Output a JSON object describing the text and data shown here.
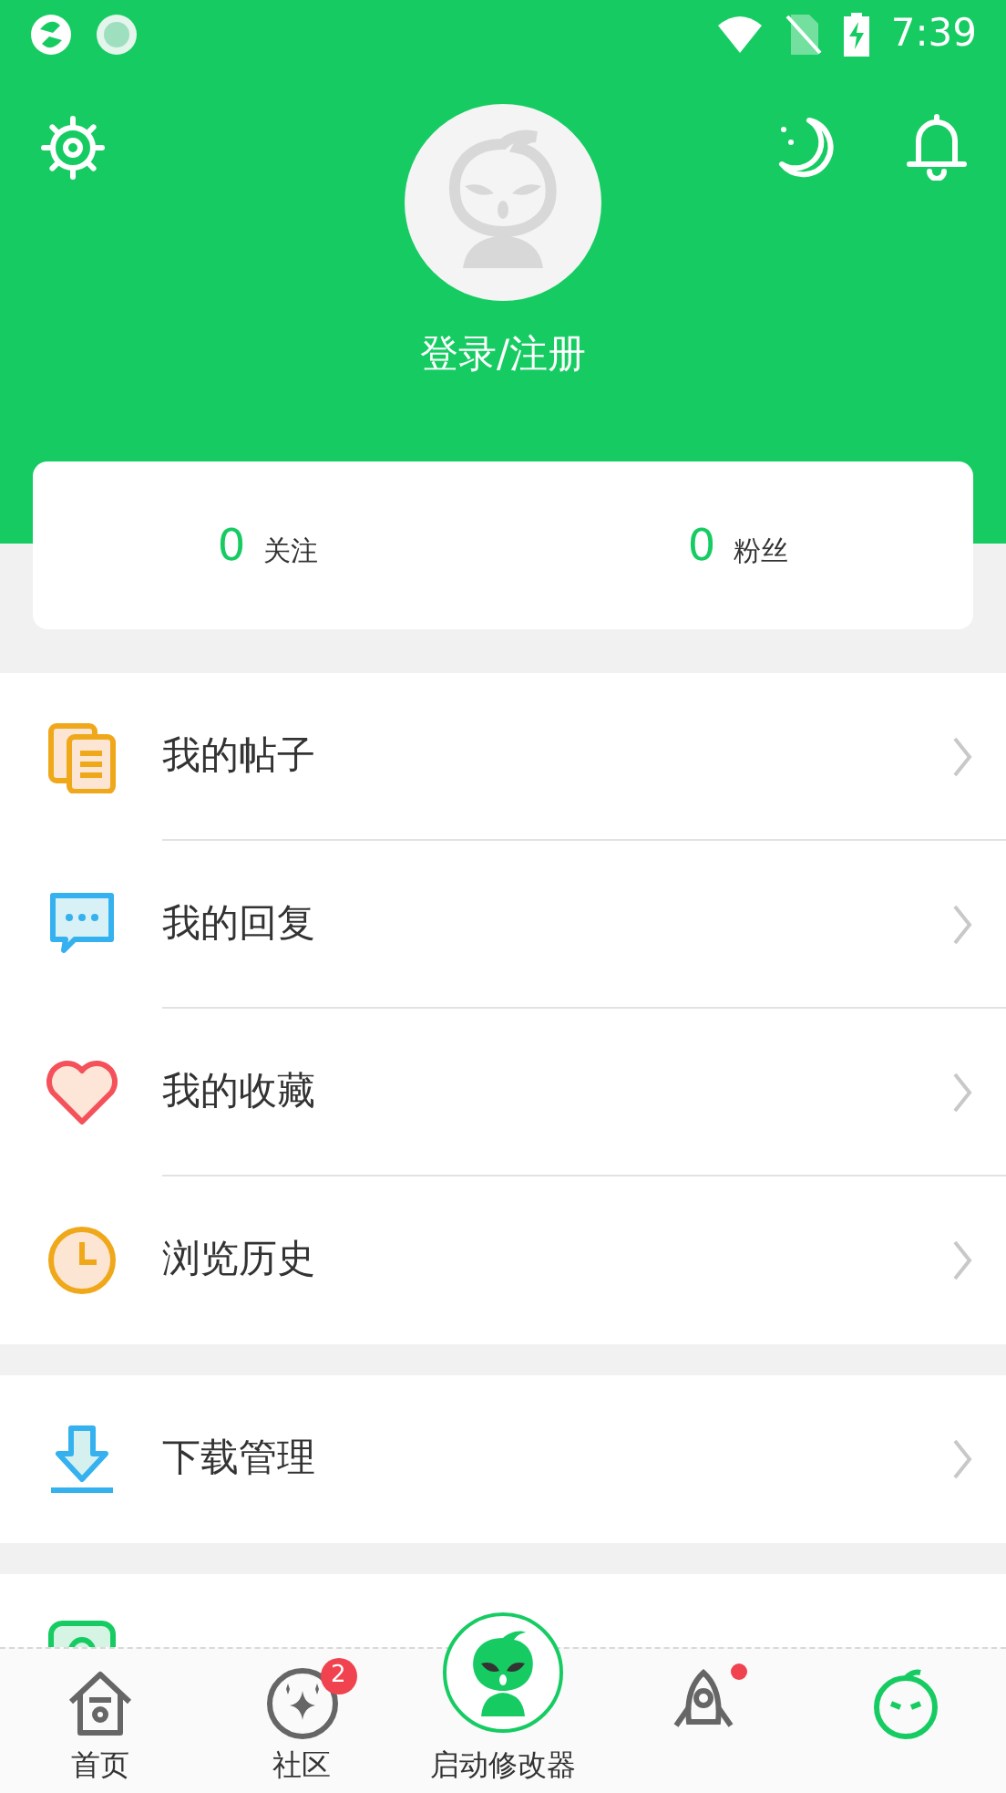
{
  "status_bar": {
    "time": "7:39"
  },
  "header": {
    "login_label": "登录/注册"
  },
  "stats": [
    {
      "count": "0",
      "label": "关注"
    },
    {
      "count": "0",
      "label": "粉丝"
    }
  ],
  "menu_groups": [
    [
      {
        "label": "我的帖子"
      },
      {
        "label": "我的回复"
      },
      {
        "label": "我的收藏"
      },
      {
        "label": "浏览历史"
      }
    ],
    [
      {
        "label": "下载管理"
      }
    ]
  ],
  "bottom_nav": [
    {
      "kind": "tab",
      "label": "首页"
    },
    {
      "kind": "tab",
      "label": "社区",
      "badge": "2"
    },
    {
      "kind": "center",
      "label": "启动修改器"
    },
    {
      "kind": "tab",
      "dot": true
    },
    {
      "kind": "tab"
    }
  ]
}
